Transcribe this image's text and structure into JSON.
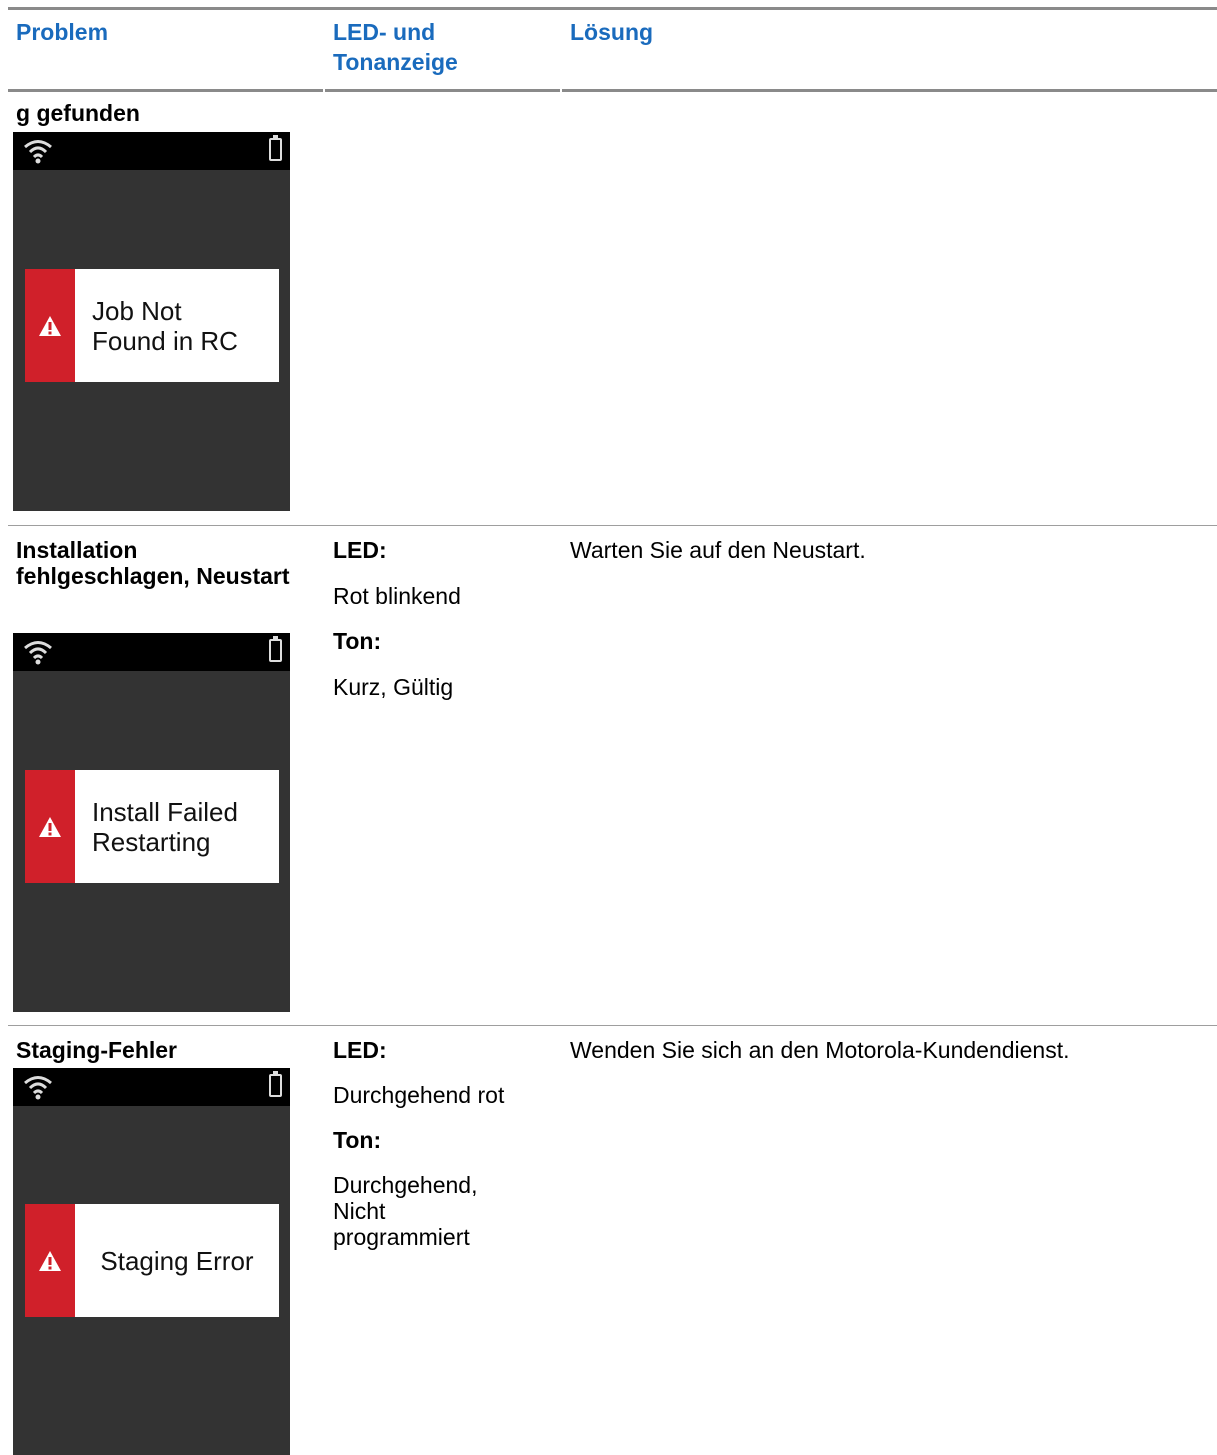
{
  "header": {
    "problem": "Problem",
    "indicator": "LED- und Tonanzeige",
    "solution": "Lösung"
  },
  "rows": [
    {
      "problem": "g gefunden",
      "screen_text": "Job Not Found in RC"
    },
    {
      "problem": "Installation fehlgeschlagen, Neustart",
      "led_label": "LED:",
      "led_value": "Rot blinkend",
      "tone_label": "Ton:",
      "tone_value": "Kurz, Gültig",
      "solution": "Warten Sie auf den Neustart.",
      "screen_text": "Install Failed Restarting"
    },
    {
      "problem": "Staging-Fehler",
      "led_label": "LED:",
      "led_value": "Durchgehend rot",
      "tone_label": "Ton:",
      "tone_value": "Durchgehend, Nicht programmiert",
      "solution": "Wenden Sie sich an den Motorola-Kundendienst.",
      "screen_text": "Staging Error"
    }
  ],
  "icons": [
    "wifi-icon",
    "battery-icon",
    "warning-icon"
  ],
  "colors": {
    "header_text": "#1a6bbd",
    "alert_red": "#d0202a",
    "screen_bg": "#333333"
  }
}
